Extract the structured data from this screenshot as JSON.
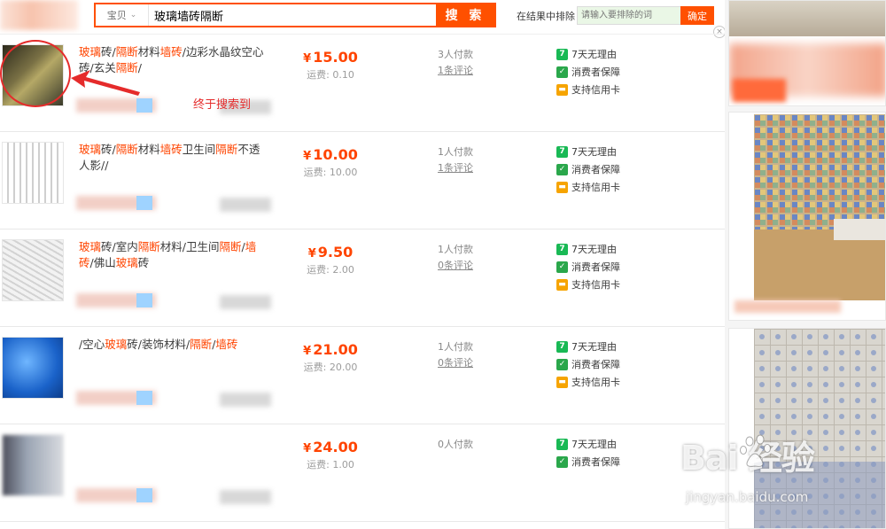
{
  "search": {
    "type_label": "宝贝",
    "query": "玻璃墙砖隔断",
    "button_label": "搜 索",
    "exclude_label": "在结果中排除",
    "exclude_placeholder": "请输入要排除的词",
    "confirm_label": "确定",
    "close_label": "×"
  },
  "colors": {
    "accent": "#ff5000",
    "highlight": "#f40",
    "annotation": "#e52b2b"
  },
  "annotation": {
    "text": "终于搜索到"
  },
  "services": {
    "return_label": "7天无理由",
    "guarantee_label": "消费者保障",
    "credit_label": "支持信用卡",
    "return_icon": "seven-day-icon",
    "guarantee_icon": "shield-icon",
    "credit_icon": "credit-card-icon"
  },
  "results": [
    {
      "title_parts": [
        {
          "t": "玻璃",
          "h": true
        },
        {
          "t": "砖/",
          "h": false
        },
        {
          "t": "隔断",
          "h": true
        },
        {
          "t": "材料",
          "h": false
        },
        {
          "t": "墙砖",
          "h": true
        },
        {
          "t": "/边彩水晶纹空心砖/玄关",
          "h": false
        },
        {
          "t": "隔断",
          "h": true
        },
        {
          "t": "/",
          "h": false
        }
      ],
      "price": "15.00",
      "shipping": "运费: 0.10",
      "buyers": "3人付款",
      "comments": "1条评论",
      "has_credit": true
    },
    {
      "title_parts": [
        {
          "t": "玻璃",
          "h": true
        },
        {
          "t": "砖/",
          "h": false
        },
        {
          "t": "隔断",
          "h": true
        },
        {
          "t": "材料",
          "h": false
        },
        {
          "t": "墙砖",
          "h": true
        },
        {
          "t": "卫生间",
          "h": false
        },
        {
          "t": "隔断",
          "h": true
        },
        {
          "t": "不透人影//",
          "h": false
        }
      ],
      "price": "10.00",
      "shipping": "运费: 10.00",
      "buyers": "1人付款",
      "comments": "1条评论",
      "has_credit": true
    },
    {
      "title_parts": [
        {
          "t": "玻璃",
          "h": true
        },
        {
          "t": "砖/室内",
          "h": false
        },
        {
          "t": "隔断",
          "h": true
        },
        {
          "t": "材料/卫生间",
          "h": false
        },
        {
          "t": "隔断",
          "h": true
        },
        {
          "t": "/",
          "h": false
        },
        {
          "t": "墙砖",
          "h": true
        },
        {
          "t": "/佛山",
          "h": false
        },
        {
          "t": "玻璃",
          "h": true
        },
        {
          "t": "砖",
          "h": false
        }
      ],
      "price": "9.50",
      "shipping": "运费: 2.00",
      "buyers": "1人付款",
      "comments": "0条评论",
      "has_credit": true
    },
    {
      "title_parts": [
        {
          "t": "/空心",
          "h": false
        },
        {
          "t": "玻璃",
          "h": true
        },
        {
          "t": "砖/装饰材料/",
          "h": false
        },
        {
          "t": "隔断",
          "h": true
        },
        {
          "t": "/",
          "h": false
        },
        {
          "t": "墙砖",
          "h": true
        }
      ],
      "price": "21.00",
      "shipping": "运费: 20.00",
      "buyers": "1人付款",
      "comments": "0条评论",
      "has_credit": true
    },
    {
      "title_parts": [],
      "price": "24.00",
      "shipping": "运费: 1.00",
      "buyers": "0人付款",
      "comments": "",
      "has_credit": false
    }
  ],
  "watermark": {
    "main": "Bai 经验",
    "sub": "jingyan.baidu.com"
  }
}
